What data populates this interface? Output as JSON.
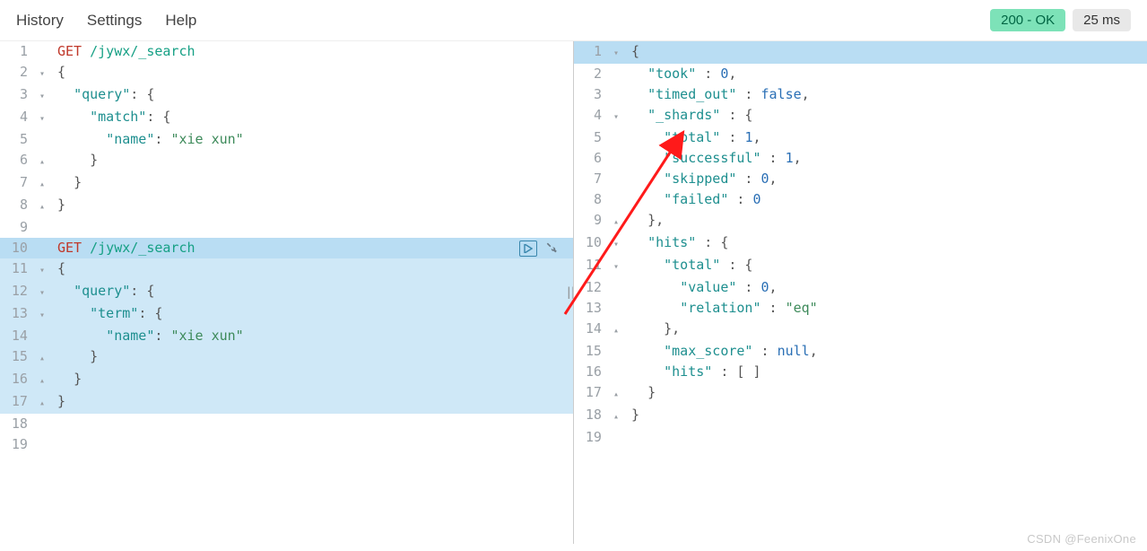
{
  "menu": {
    "history": "History",
    "settings": "Settings",
    "help": "Help"
  },
  "status": {
    "code_text": "200 - OK",
    "time_text": "25 ms"
  },
  "request_editor": {
    "lines": [
      {
        "n": "1",
        "fold": "",
        "hl": false,
        "tokens": [
          [
            "method",
            "GET"
          ],
          [
            "plain",
            " "
          ],
          [
            "path",
            "/jywx/_search"
          ]
        ]
      },
      {
        "n": "2",
        "fold": "▾",
        "hl": false,
        "tokens": [
          [
            "punct",
            "{"
          ]
        ]
      },
      {
        "n": "3",
        "fold": "▾",
        "hl": false,
        "tokens": [
          [
            "plain",
            "  "
          ],
          [
            "key",
            "\"query\""
          ],
          [
            "punct",
            ": {"
          ]
        ]
      },
      {
        "n": "4",
        "fold": "▾",
        "hl": false,
        "tokens": [
          [
            "plain",
            "    "
          ],
          [
            "key",
            "\"match\""
          ],
          [
            "punct",
            ": {"
          ]
        ]
      },
      {
        "n": "5",
        "fold": "",
        "hl": false,
        "tokens": [
          [
            "plain",
            "      "
          ],
          [
            "key",
            "\"name\""
          ],
          [
            "punct",
            ": "
          ],
          [
            "str",
            "\"xie xun\""
          ]
        ]
      },
      {
        "n": "6",
        "fold": "▴",
        "hl": false,
        "tokens": [
          [
            "plain",
            "    "
          ],
          [
            "punct",
            "}"
          ]
        ]
      },
      {
        "n": "7",
        "fold": "▴",
        "hl": false,
        "tokens": [
          [
            "plain",
            "  "
          ],
          [
            "punct",
            "}"
          ]
        ]
      },
      {
        "n": "8",
        "fold": "▴",
        "hl": false,
        "tokens": [
          [
            "punct",
            "}"
          ]
        ]
      },
      {
        "n": "9",
        "fold": "",
        "hl": false,
        "tokens": []
      },
      {
        "n": "10",
        "fold": "",
        "hl": "first",
        "tokens": [
          [
            "method",
            "GET"
          ],
          [
            "plain",
            " "
          ],
          [
            "path",
            "/jywx/_search"
          ]
        ]
      },
      {
        "n": "11",
        "fold": "▾",
        "hl": true,
        "tokens": [
          [
            "punct",
            "{"
          ]
        ]
      },
      {
        "n": "12",
        "fold": "▾",
        "hl": true,
        "tokens": [
          [
            "plain",
            "  "
          ],
          [
            "key",
            "\"query\""
          ],
          [
            "punct",
            ": {"
          ]
        ]
      },
      {
        "n": "13",
        "fold": "▾",
        "hl": true,
        "tokens": [
          [
            "plain",
            "    "
          ],
          [
            "key",
            "\"term\""
          ],
          [
            "punct",
            ": {"
          ]
        ]
      },
      {
        "n": "14",
        "fold": "",
        "hl": true,
        "tokens": [
          [
            "plain",
            "      "
          ],
          [
            "key",
            "\"name\""
          ],
          [
            "punct",
            ": "
          ],
          [
            "str",
            "\"xie xun\""
          ]
        ]
      },
      {
        "n": "15",
        "fold": "▴",
        "hl": true,
        "tokens": [
          [
            "plain",
            "    "
          ],
          [
            "punct",
            "}"
          ]
        ]
      },
      {
        "n": "16",
        "fold": "▴",
        "hl": true,
        "tokens": [
          [
            "plain",
            "  "
          ],
          [
            "punct",
            "}"
          ]
        ]
      },
      {
        "n": "17",
        "fold": "▴",
        "hl": true,
        "tokens": [
          [
            "punct",
            "}"
          ]
        ]
      },
      {
        "n": "18",
        "fold": "",
        "hl": false,
        "tokens": []
      },
      {
        "n": "19",
        "fold": "",
        "hl": false,
        "tokens": []
      }
    ]
  },
  "response_editor": {
    "lines": [
      {
        "n": "1",
        "fold": "▾",
        "hl": "first",
        "tokens": [
          [
            "punct",
            "{"
          ]
        ]
      },
      {
        "n": "2",
        "fold": "",
        "hl": false,
        "tokens": [
          [
            "plain",
            "  "
          ],
          [
            "key",
            "\"took\""
          ],
          [
            "punct",
            " : "
          ],
          [
            "num",
            "0"
          ],
          [
            "punct",
            ","
          ]
        ]
      },
      {
        "n": "3",
        "fold": "",
        "hl": false,
        "tokens": [
          [
            "plain",
            "  "
          ],
          [
            "key",
            "\"timed_out\""
          ],
          [
            "punct",
            " : "
          ],
          [
            "bool",
            "false"
          ],
          [
            "punct",
            ","
          ]
        ]
      },
      {
        "n": "4",
        "fold": "▾",
        "hl": false,
        "tokens": [
          [
            "plain",
            "  "
          ],
          [
            "key",
            "\"_shards\""
          ],
          [
            "punct",
            " : {"
          ]
        ]
      },
      {
        "n": "5",
        "fold": "",
        "hl": false,
        "tokens": [
          [
            "plain",
            "    "
          ],
          [
            "key",
            "\"total\""
          ],
          [
            "punct",
            " : "
          ],
          [
            "num",
            "1"
          ],
          [
            "punct",
            ","
          ]
        ]
      },
      {
        "n": "6",
        "fold": "",
        "hl": false,
        "tokens": [
          [
            "plain",
            "    "
          ],
          [
            "key",
            "\"successful\""
          ],
          [
            "punct",
            " : "
          ],
          [
            "num",
            "1"
          ],
          [
            "punct",
            ","
          ]
        ]
      },
      {
        "n": "7",
        "fold": "",
        "hl": false,
        "tokens": [
          [
            "plain",
            "    "
          ],
          [
            "key",
            "\"skipped\""
          ],
          [
            "punct",
            " : "
          ],
          [
            "num",
            "0"
          ],
          [
            "punct",
            ","
          ]
        ]
      },
      {
        "n": "8",
        "fold": "",
        "hl": false,
        "tokens": [
          [
            "plain",
            "    "
          ],
          [
            "key",
            "\"failed\""
          ],
          [
            "punct",
            " : "
          ],
          [
            "num",
            "0"
          ]
        ]
      },
      {
        "n": "9",
        "fold": "▴",
        "hl": false,
        "tokens": [
          [
            "plain",
            "  "
          ],
          [
            "punct",
            "},"
          ]
        ]
      },
      {
        "n": "10",
        "fold": "▾",
        "hl": false,
        "tokens": [
          [
            "plain",
            "  "
          ],
          [
            "key",
            "\"hits\""
          ],
          [
            "punct",
            " : {"
          ]
        ]
      },
      {
        "n": "11",
        "fold": "▾",
        "hl": false,
        "tokens": [
          [
            "plain",
            "    "
          ],
          [
            "key",
            "\"total\""
          ],
          [
            "punct",
            " : {"
          ]
        ]
      },
      {
        "n": "12",
        "fold": "",
        "hl": false,
        "tokens": [
          [
            "plain",
            "      "
          ],
          [
            "key",
            "\"value\""
          ],
          [
            "punct",
            " : "
          ],
          [
            "num",
            "0"
          ],
          [
            "punct",
            ","
          ]
        ]
      },
      {
        "n": "13",
        "fold": "",
        "hl": false,
        "tokens": [
          [
            "plain",
            "      "
          ],
          [
            "key",
            "\"relation\""
          ],
          [
            "punct",
            " : "
          ],
          [
            "str",
            "\"eq\""
          ]
        ]
      },
      {
        "n": "14",
        "fold": "▴",
        "hl": false,
        "tokens": [
          [
            "plain",
            "    "
          ],
          [
            "punct",
            "},"
          ]
        ]
      },
      {
        "n": "15",
        "fold": "",
        "hl": false,
        "tokens": [
          [
            "plain",
            "    "
          ],
          [
            "key",
            "\"max_score\""
          ],
          [
            "punct",
            " : "
          ],
          [
            "null",
            "null"
          ],
          [
            "punct",
            ","
          ]
        ]
      },
      {
        "n": "16",
        "fold": "",
        "hl": false,
        "tokens": [
          [
            "plain",
            "    "
          ],
          [
            "key",
            "\"hits\""
          ],
          [
            "punct",
            " : [ ]"
          ]
        ]
      },
      {
        "n": "17",
        "fold": "▴",
        "hl": false,
        "tokens": [
          [
            "plain",
            "  "
          ],
          [
            "punct",
            "}"
          ]
        ]
      },
      {
        "n": "18",
        "fold": "▴",
        "hl": false,
        "tokens": [
          [
            "punct",
            "}"
          ]
        ]
      },
      {
        "n": "19",
        "fold": "",
        "hl": false,
        "tokens": []
      }
    ]
  },
  "watermark": "CSDN @FeenixOne",
  "icons": {
    "play_glyph": "▷",
    "wrench_glyph": "🔧"
  }
}
